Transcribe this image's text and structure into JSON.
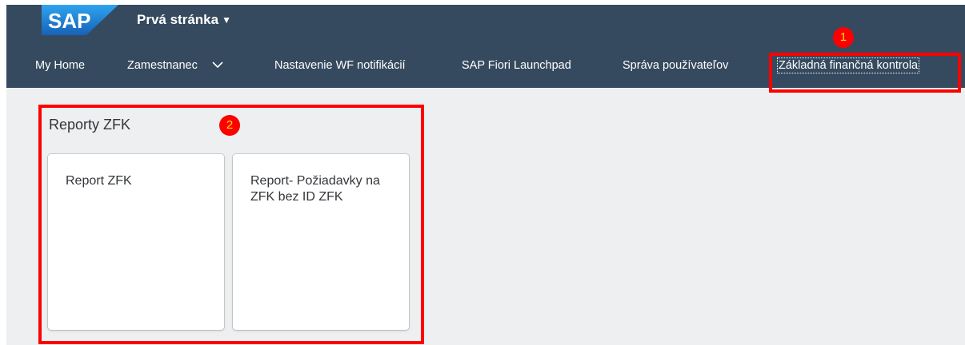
{
  "header": {
    "logo_text": "SAP",
    "title": "Prvá stránka",
    "title_caret": "▼"
  },
  "nav": {
    "items": [
      {
        "label": "My Home"
      },
      {
        "label": "Zamestnanec"
      },
      {
        "label": "Nastavenie WF notifikácií"
      },
      {
        "label": "SAP Fiori Launchpad"
      },
      {
        "label": "Správa používateľov"
      },
      {
        "label": "Základná finančná kontrola"
      }
    ]
  },
  "group": {
    "title": "Reporty ZFK",
    "tiles": [
      {
        "label": "Report ZFK"
      },
      {
        "label": "Report- Požiadavky na ZFK bez ID ZFK"
      }
    ]
  },
  "annotations": {
    "markers": [
      "1",
      "2"
    ],
    "color": "#ff0000",
    "number_color": "#ffe000"
  },
  "colors": {
    "shell": "#354a5f",
    "page_background": "#edeff0",
    "logo_blue": "#1f7fd1"
  }
}
